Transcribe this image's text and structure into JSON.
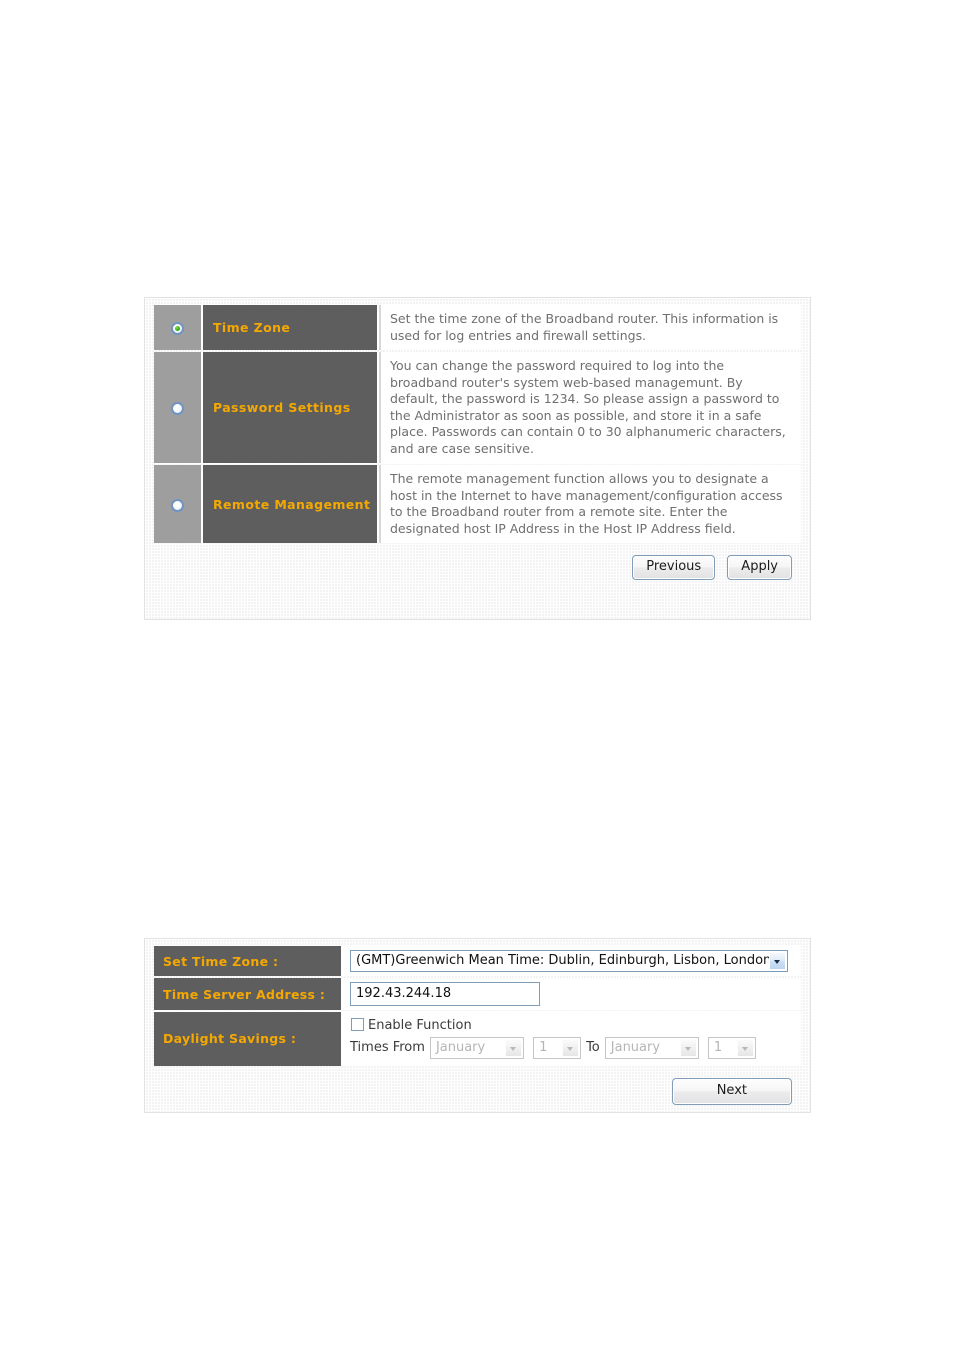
{
  "settings_panel": {
    "options": [
      {
        "selected": true,
        "name": "Time Zone",
        "description": "Set the time zone of the Broadband router. This information is used for log entries and firewall settings."
      },
      {
        "selected": false,
        "name": "Password Settings",
        "description": "You can change the password required to log into the broadband router's system web-based managemunt. By default, the password is 1234. So please assign a password to the Administrator as soon as possible, and store it in a safe place. Passwords can contain 0 to 30 alphanumeric characters, and are case sensitive."
      },
      {
        "selected": false,
        "name": "Remote Management",
        "description": "The remote management function allows you to designate a host in the Internet to have management/configuration access to the Broadband router from a remote site. Enter the designated host IP Address in the Host IP Address field."
      }
    ],
    "buttons": {
      "previous": "Previous",
      "apply": "Apply"
    }
  },
  "timezone_panel": {
    "labels": {
      "set_time_zone": "Set Time Zone :",
      "time_server_address": "Time Server Address :",
      "daylight_savings": "Daylight Savings :"
    },
    "time_zone_value": "(GMT)Greenwich Mean Time: Dublin, Edinburgh, Lisbon, London",
    "time_server_value": "192.43.244.18",
    "daylight": {
      "enable_label": "Enable Function",
      "enabled": false,
      "times_from_label": "Times From",
      "to_label": "To",
      "from_month": "January",
      "from_day": "1",
      "to_month": "January",
      "to_day": "1"
    },
    "buttons": {
      "next": "Next"
    }
  },
  "colors": {
    "label_cell_bg": "#5e5e5e",
    "radio_cell_bg": "#9e9e9e",
    "label_text": "#f5a800",
    "description_text": "#6f6f6f",
    "panel_bg": "#f3f3f3",
    "control_border": "#7f9db9"
  }
}
